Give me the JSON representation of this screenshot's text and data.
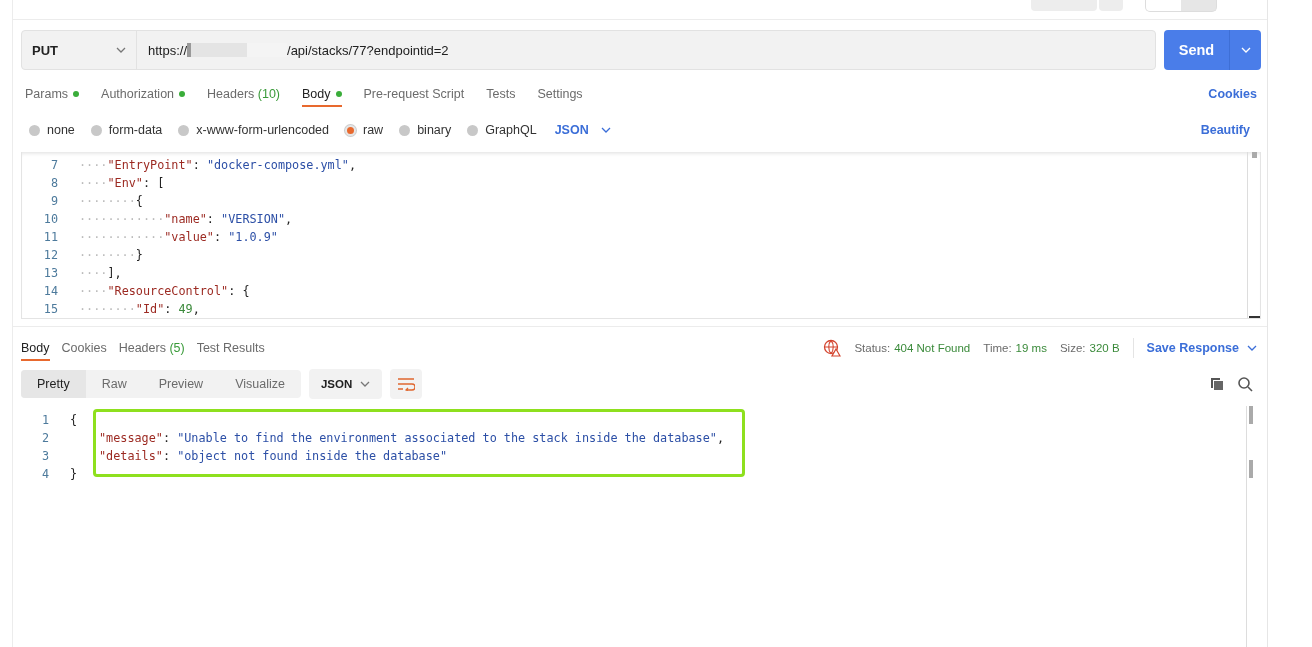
{
  "request": {
    "method": "PUT",
    "url_start": "https://",
    "url_end": "/api/stacks/77?endpointid=2",
    "send_label": "Send"
  },
  "request_tabs": [
    {
      "label": "Params",
      "indicator": true,
      "selected": false
    },
    {
      "label": "Authorization",
      "indicator": true,
      "selected": false
    },
    {
      "label": "Headers",
      "count": "(10)",
      "indicator": false,
      "selected": false
    },
    {
      "label": "Body",
      "indicator": true,
      "selected": true
    },
    {
      "label": "Pre-request Script",
      "indicator": false,
      "selected": false
    },
    {
      "label": "Tests",
      "indicator": false,
      "selected": false
    },
    {
      "label": "Settings",
      "indicator": false,
      "selected": false
    }
  ],
  "cookies_link": "Cookies",
  "body_types": [
    {
      "label": "none",
      "selected": false
    },
    {
      "label": "form-data",
      "selected": false
    },
    {
      "label": "x-www-form-urlencoded",
      "selected": false
    },
    {
      "label": "raw",
      "selected": true
    },
    {
      "label": "binary",
      "selected": false
    },
    {
      "label": "GraphQL",
      "selected": false
    }
  ],
  "body_format": "JSON",
  "beautify": "Beautify",
  "request_body": {
    "lines": [
      {
        "number": "7",
        "tokens": [
          {
            "kind": "ws",
            "text": "····"
          },
          {
            "kind": "key",
            "text": "\"EntryPoint\""
          },
          {
            "kind": "punct",
            "text": ": "
          },
          {
            "kind": "string",
            "text": "\"docker-compose.yml\""
          },
          {
            "kind": "punct",
            "text": ","
          }
        ]
      },
      {
        "number": "8",
        "tokens": [
          {
            "kind": "ws",
            "text": "····"
          },
          {
            "kind": "key",
            "text": "\"Env\""
          },
          {
            "kind": "punct",
            "text": ": ["
          }
        ]
      },
      {
        "number": "9",
        "tokens": [
          {
            "kind": "ws",
            "text": "········"
          },
          {
            "kind": "punct",
            "text": "{"
          }
        ]
      },
      {
        "number": "10",
        "tokens": [
          {
            "kind": "ws",
            "text": "············"
          },
          {
            "kind": "key",
            "text": "\"name\""
          },
          {
            "kind": "punct",
            "text": ": "
          },
          {
            "kind": "string",
            "text": "\"VERSION\""
          },
          {
            "kind": "punct",
            "text": ","
          }
        ]
      },
      {
        "number": "11",
        "tokens": [
          {
            "kind": "ws",
            "text": "············"
          },
          {
            "kind": "key",
            "text": "\"value\""
          },
          {
            "kind": "punct",
            "text": ": "
          },
          {
            "kind": "string",
            "text": "\"1.0.9\""
          }
        ]
      },
      {
        "number": "12",
        "tokens": [
          {
            "kind": "ws",
            "text": "········"
          },
          {
            "kind": "punct",
            "text": "}"
          }
        ]
      },
      {
        "number": "13",
        "tokens": [
          {
            "kind": "ws",
            "text": "····"
          },
          {
            "kind": "punct",
            "text": "],"
          }
        ]
      },
      {
        "number": "14",
        "tokens": [
          {
            "kind": "ws",
            "text": "····"
          },
          {
            "kind": "key",
            "text": "\"ResourceControl\""
          },
          {
            "kind": "punct",
            "text": ": {"
          }
        ]
      },
      {
        "number": "15",
        "tokens": [
          {
            "kind": "ws",
            "text": "········"
          },
          {
            "kind": "key",
            "text": "\"Id\""
          },
          {
            "kind": "punct",
            "text": ": "
          },
          {
            "kind": "number",
            "text": "49"
          },
          {
            "kind": "punct",
            "text": ","
          }
        ]
      }
    ]
  },
  "response": {
    "tabs": [
      {
        "label": "Body",
        "selected": true
      },
      {
        "label": "Cookies",
        "selected": false
      },
      {
        "label": "Headers",
        "count": "(5)",
        "selected": false
      },
      {
        "label": "Test Results",
        "selected": false
      }
    ],
    "status_label": "Status:",
    "status": "404 Not Found",
    "time_label": "Time:",
    "time": "19 ms",
    "size_label": "Size:",
    "size": "320 B",
    "save_label": "Save Response",
    "views": [
      {
        "label": "Pretty",
        "selected": true
      },
      {
        "label": "Raw",
        "selected": false
      },
      {
        "label": "Preview",
        "selected": false
      },
      {
        "label": "Visualize",
        "selected": false
      }
    ],
    "format": "JSON",
    "lines": [
      {
        "number": "1",
        "highlighted": false,
        "tokens": [
          {
            "kind": "punct",
            "text": "{"
          }
        ]
      },
      {
        "number": "2",
        "highlighted": true,
        "tokens": [
          {
            "kind": "key",
            "text": "\"message\""
          },
          {
            "kind": "punct",
            "text": ": "
          },
          {
            "kind": "string",
            "text": "\"Unable to find the environment associated to the stack inside the database\""
          },
          {
            "kind": "punct",
            "text": ","
          }
        ]
      },
      {
        "number": "3",
        "highlighted": true,
        "tokens": [
          {
            "kind": "key",
            "text": "\"details\""
          },
          {
            "kind": "punct",
            "text": ": "
          },
          {
            "kind": "string",
            "text": "\"object not found inside the database\""
          }
        ]
      },
      {
        "number": "4",
        "highlighted": false,
        "tokens": [
          {
            "kind": "punct",
            "text": "}"
          }
        ]
      }
    ]
  }
}
